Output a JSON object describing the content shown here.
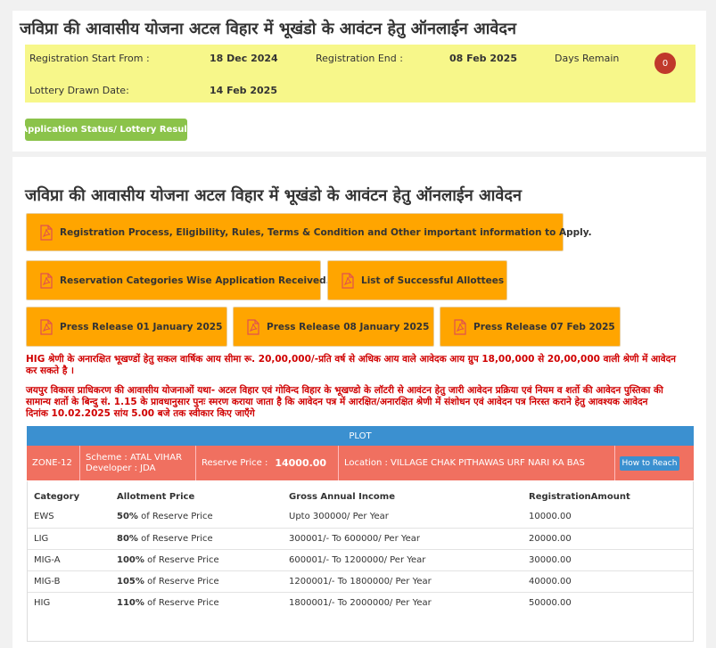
{
  "header": {
    "title": "जविप्रा की आवासीय योजना अटल विहार में भूखंडो के आवंटन हेतु ऑनलाईन आवेदन",
    "reg_start_label": "Registration Start From :",
    "reg_start_value": "18 Dec 2024",
    "reg_end_label": "Registration End :",
    "reg_end_value": "08 Feb 2025",
    "days_remain_label": "Days Remain",
    "days_remain_value": "0",
    "lottery_label": "Lottery Drawn Date:",
    "lottery_value": "14 Feb 2025",
    "status_button": "Application Status/ Lottery Result"
  },
  "main": {
    "title": "जविप्रा की आवासीय योजना अटल विहार में भूखंडो के आवंटन हेतु ऑनलाईन आवेदन",
    "buttons": {
      "registration_process": "Registration Process, Eligibility, Rules, Terms & Condition and Other important information to Apply.",
      "reservation_categories": "Reservation Categories Wise Application Received.",
      "successful_allottees": "List of Successful Allottees",
      "press_release_1": "Press Release 01 January 2025",
      "press_release_2": "Press Release 08 January 2025",
      "press_release_3": "Press Release 07 Feb 2025"
    },
    "notice_1_line1": "HIG श्रेणी के अनारक्षित भूखण्डों हेतु सकल वार्षिक आय सीमा रू. 20,00,000/-प्रति वर्ष से अधिक आय वाले आवेदक आय ग्रुप 18,00,000 से 20,00,000 वाली श्रेणी में आवेदन",
    "notice_1_line2": "कर सकते है ।",
    "notice_2_line1": "जयपुर विकास प्राधिकरण की आवासीय योजनाओं यथा- अटल विहार एवं गोविन्द विहार के भूखण्डो के लॉटरी से आवंटन हेतु जारी आवेदन प्रक्रिया एवं नियम व शर्तो की आवेदन पुस्तिका की",
    "notice_2_line2": "सामान्य शर्तो के बिन्दु सं. 1.15 के प्रावधानुसार पुनः स्मरण कराया जाता है कि आवेदन पत्र में आरक्षित/अनारक्षित श्रेणी में संशोधन एवं आवेदन पत्र निरस्त कराने हेतु आवश्यक आवेदन",
    "notice_2_line3": "दिनांक 10.02.2025 सांय 5.00 बजे तक स्वीकार किए जाएँगे"
  },
  "plot": {
    "header": "PLOT",
    "zone": "ZONE-12",
    "scheme": "Scheme : ATAL VIHAR",
    "developer": "Developer : JDA",
    "reserve_price_label": "Reserve Price :",
    "reserve_price_value": "14000.00",
    "location": "Location : VILLAGE CHAK PITHAWAS URF NARI KA BAS",
    "how_to_reach": "How to Reach"
  },
  "categories": {
    "headers": {
      "category": "Category",
      "allotment_price": "Allotment Price",
      "gross_income": "Gross Annual Income",
      "registration_amount": "RegistrationAmount"
    },
    "rows": [
      {
        "category": "EWS",
        "pct": "50%",
        "price_suffix": " of Reserve Price",
        "income": "Upto 300000/ Per Year",
        "amount": "10000.00"
      },
      {
        "category": "LIG",
        "pct": "80%",
        "price_suffix": " of Reserve Price",
        "income": "300001/- To 600000/ Per Year",
        "amount": "20000.00"
      },
      {
        "category": "MIG-A",
        "pct": "100%",
        "price_suffix": " of Reserve Price",
        "income": "600001/- To 1200000/ Per Year",
        "amount": "30000.00"
      },
      {
        "category": "MIG-B",
        "pct": "105%",
        "price_suffix": " of Reserve Price",
        "income": "1200001/- To 1800000/ Per Year",
        "amount": "40000.00"
      },
      {
        "category": "HIG",
        "pct": "110%",
        "price_suffix": " of Reserve Price",
        "income": "1800001/- To 2000000/ Per Year",
        "amount": "50000.00"
      }
    ]
  }
}
